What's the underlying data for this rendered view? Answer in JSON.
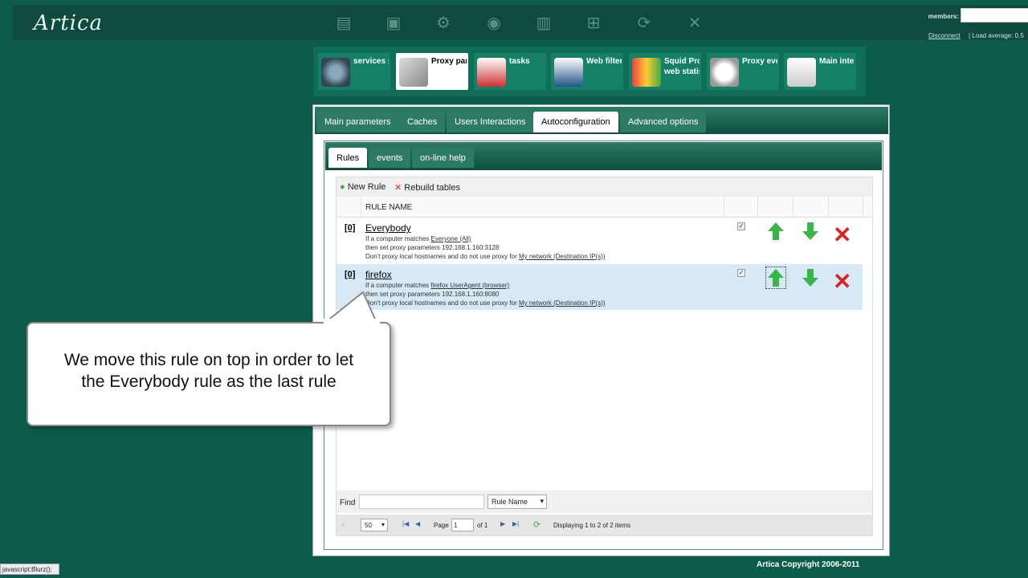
{
  "header": {
    "logo": "Artica",
    "members_label": "members:",
    "disconnect": "Disconnect",
    "load_average": "| Load average: 0.5",
    "icons": [
      "folder-icon",
      "monitor-search-icon",
      "gear-icon",
      "globe-search-icon",
      "chart-icon",
      "network-icon",
      "refresh-icon",
      "close-icon"
    ]
  },
  "modules": [
    {
      "label": "services s",
      "icon": "gears-icon",
      "active": false
    },
    {
      "label": "Proxy para",
      "icon": "wrench-icon",
      "active": true
    },
    {
      "label": "tasks",
      "icon": "checklist-icon",
      "active": false
    },
    {
      "label": "Web filteri",
      "icon": "web-filter-icon",
      "active": false
    },
    {
      "label": "Squid Prox\nweb statis",
      "icon": "stats-icon",
      "active": false
    },
    {
      "label": "Proxy eve",
      "icon": "magnifier-icon",
      "active": false
    },
    {
      "label": "Main inter",
      "icon": "form-icon",
      "active": false
    }
  ],
  "tabs_main": [
    "Main parameters",
    "Caches",
    "Users Interactions",
    "Autoconfiguration",
    "Advanced options"
  ],
  "tabs_sub": [
    "Rules",
    "events",
    "on-line help"
  ],
  "toolbar": {
    "new_rule": "New Rule",
    "rebuild": "Rebuild tables"
  },
  "table": {
    "header": "RULE NAME",
    "rows": [
      {
        "index": "[0]",
        "name": "Everybody",
        "line1_prefix": "If a computer matches ",
        "line1_link": "Everyone (All)",
        "line2": "then set proxy parameters 192.168.1.160:3128",
        "line3_prefix": "Don't proxy local hostnames and do not use proxy for ",
        "line3_link": "My network (Destination IP(s))"
      },
      {
        "index": "[0]",
        "name": "firefox",
        "line1_prefix": "If a computer matches ",
        "line1_link": "firefox UserAgent (browser)",
        "line2": "then set proxy parameters 192.168.1.160:8080",
        "line3_prefix": "Don't proxy local hostnames and do not use proxy for ",
        "line3_link": "My network (Destination IP(s))"
      }
    ]
  },
  "find": {
    "label": "Find",
    "field_select": "Rule Name"
  },
  "pager": {
    "per_page": "50",
    "page_label": "Page",
    "page": "1",
    "of": "of 1",
    "displaying": "Displaying 1 to 2 of 2 items"
  },
  "callout": {
    "line1": "We move this rule on top in order to let",
    "line2": "the Everybody rule as the last rule"
  },
  "footer": "Artica Copyright 2006-2011",
  "status_bar": "javascript:Blurz();"
}
